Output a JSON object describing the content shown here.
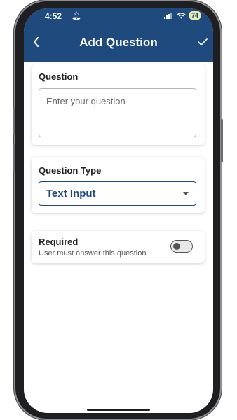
{
  "status_bar": {
    "time": "4:52",
    "battery": "74"
  },
  "app_bar": {
    "title": "Add Question"
  },
  "question_card": {
    "label": "Question",
    "placeholder": "Enter your question"
  },
  "type_card": {
    "label": "Question Type",
    "selected": "Text Input"
  },
  "required_card": {
    "label": "Required",
    "description": "User must answer this question",
    "enabled": false
  },
  "colors": {
    "primary": "#1e4a7e",
    "surface": "#ffffff"
  },
  "icons": [
    "back-icon",
    "check-icon",
    "dropdown-caret-icon",
    "signal-icon",
    "wifi-icon",
    "battery-icon",
    "bell-icon"
  ]
}
